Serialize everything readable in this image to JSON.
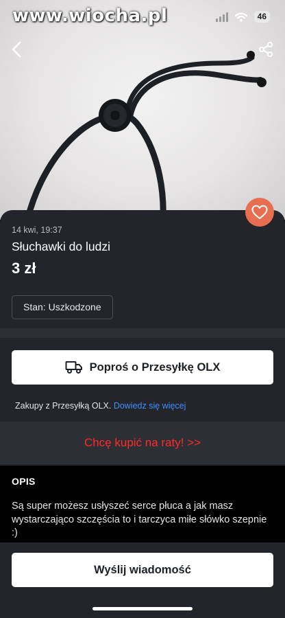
{
  "watermark": "www.wiocha.pl",
  "status": {
    "battery": "46"
  },
  "listing": {
    "date": "14 kwi, 19:37",
    "title": "Słuchawki do ludzi",
    "price": "3 zł",
    "condition": "Stan: Uszkodzone"
  },
  "delivery": {
    "button_label": "Poproś o Przesyłkę OLX",
    "info_text": "Zakupy z Przesyłką OLX.",
    "info_link": "Dowiedz się więcej"
  },
  "installments": "Chcę kupić na raty! >>",
  "description": {
    "heading": "OPIS",
    "text": "Są super możesz usłyszeć serce płuca a jak masz wystarczająco szczęścia to i tarczyca miłe słówko szepnie :)"
  },
  "message_button": "Wyślij wiadomość",
  "icons": {
    "back": "back-arrow-icon",
    "share": "share-icon",
    "favorite": "heart-icon",
    "delivery": "truck-icon",
    "wifi": "wifi-icon",
    "signal": "signal-icon"
  },
  "colors": {
    "sheet": "#23252a",
    "favorite": "#e76f51",
    "link": "#3d8fff",
    "installments": "#ff2a2a"
  }
}
